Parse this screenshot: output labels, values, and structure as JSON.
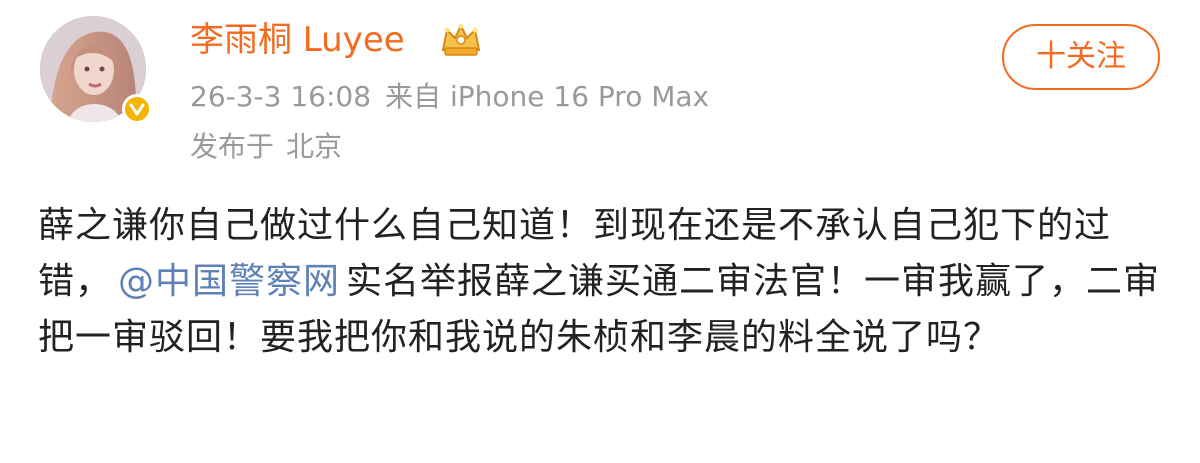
{
  "post": {
    "author": {
      "name": "李雨桐 Luyee",
      "avatar_icon": "user-avatar",
      "verified_icon": "verified-badge-icon",
      "vip_icon": "vip-crown-icon"
    },
    "timestamp": "26-3-3 16:08",
    "source": "来自 iPhone 16 Pro Max",
    "location_prefix": "发布于",
    "location": "北京",
    "follow_button": "十关注",
    "content": {
      "part1": "薛之谦你自己做过什么自己知道！到现在还是不承认自己犯下的过错，",
      "mention": "@中国警察网",
      "part2": "实名举报薛之谦买通二审法官！一审我赢了，二审把一审驳回！要我把你和我说的朱桢和李晨的料全说了吗？"
    }
  },
  "colors": {
    "username": "#f26b1f",
    "follow_button": "#f26b1f",
    "meta_text": "#9a9a9a",
    "mention": "#5e82b8",
    "verified_badge": "#f6b400",
    "body_text": "#222222"
  }
}
